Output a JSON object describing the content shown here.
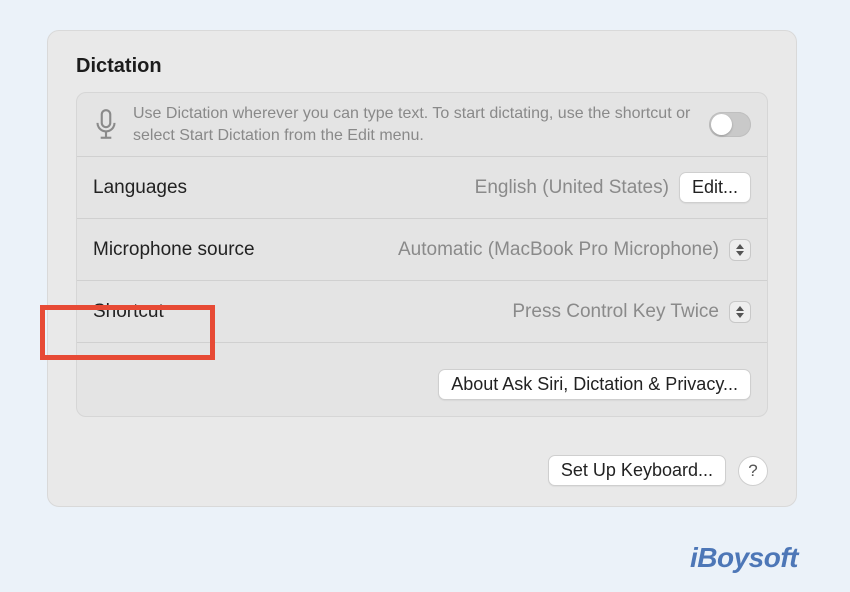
{
  "panel": {
    "title": "Dictation",
    "description": "Use Dictation wherever you can type text. To start dictating, use the shortcut or select Start Dictation from the Edit menu.",
    "toggle_on": false
  },
  "languages": {
    "label": "Languages",
    "value": "English (United States)",
    "edit_label": "Edit..."
  },
  "mic": {
    "label": "Microphone source",
    "value": "Automatic (MacBook Pro Microphone)"
  },
  "shortcut": {
    "label": "Shortcut",
    "value": "Press Control Key Twice"
  },
  "privacy_button": "About Ask Siri, Dictation & Privacy...",
  "footer": {
    "setup_button": "Set Up Keyboard...",
    "help": "?"
  },
  "watermark": "iBoysoft"
}
